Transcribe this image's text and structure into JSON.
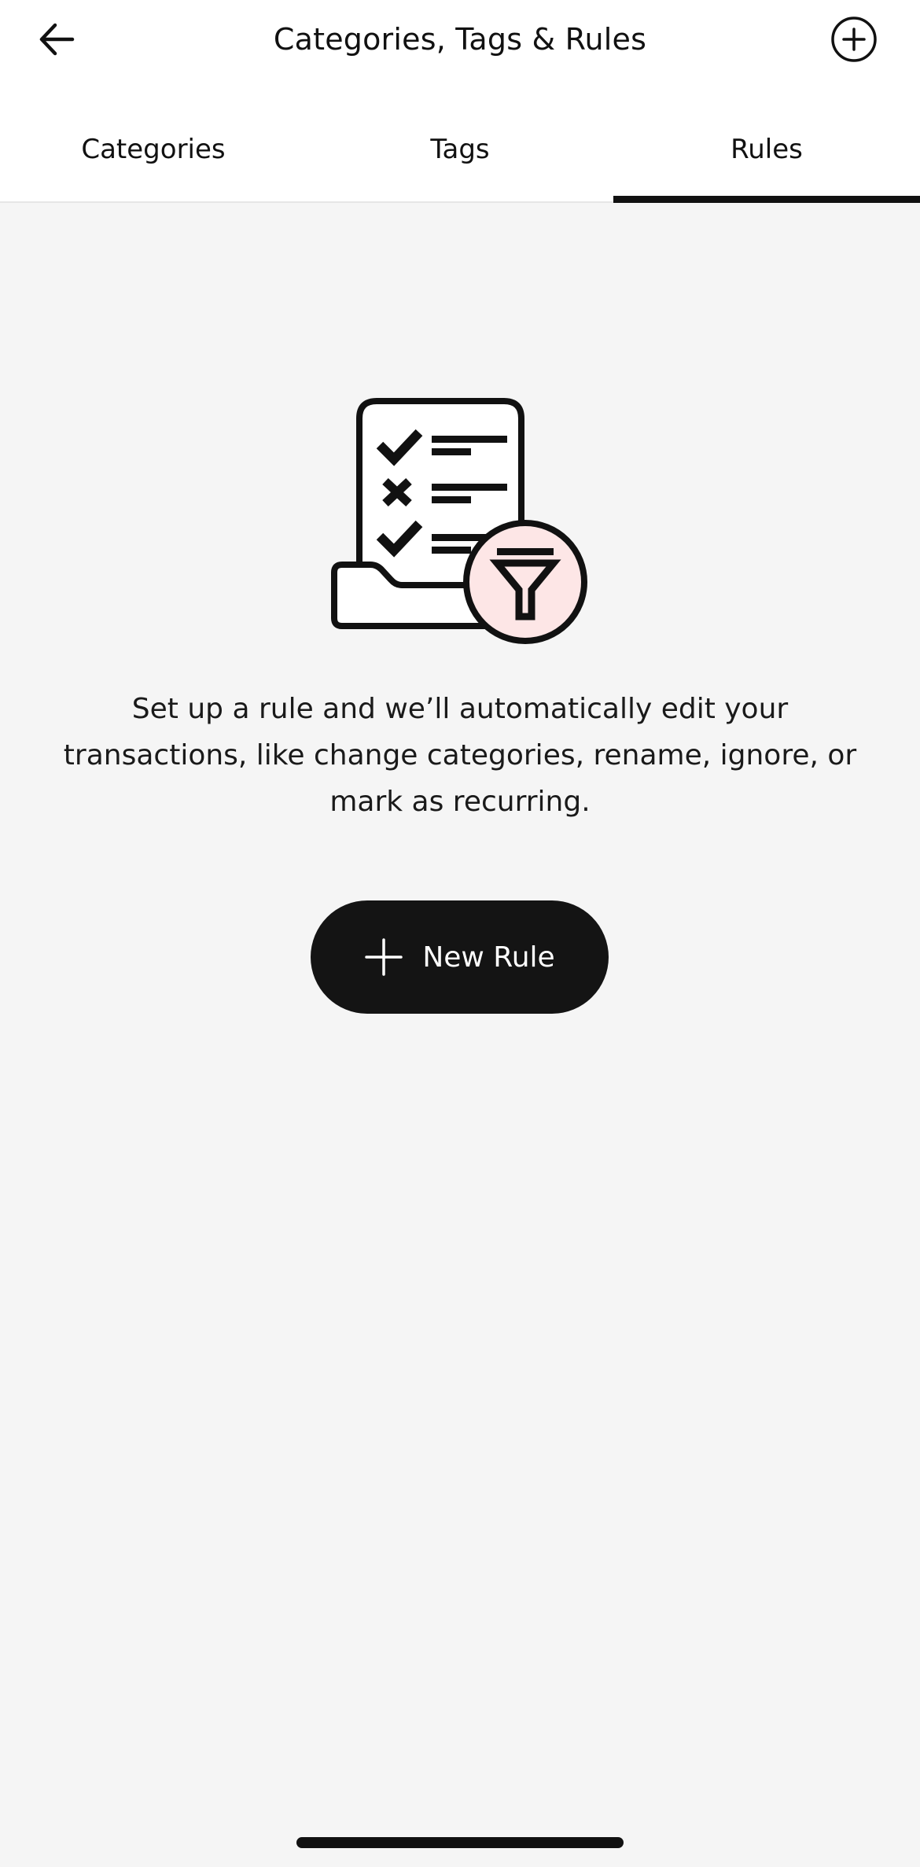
{
  "header": {
    "title": "Categories, Tags & Rules",
    "back_icon": "arrow-left-icon",
    "add_icon": "plus-circle-icon"
  },
  "tabs": [
    {
      "label": "Categories",
      "active": false
    },
    {
      "label": "Tags",
      "active": false
    },
    {
      "label": "Rules",
      "active": true
    }
  ],
  "empty_state": {
    "illustration_icon": "rules-checklist-filter-icon",
    "message": "Set up a rule and we’ll automatically edit your transactions, like change categories, rename, ignore, or mark as recurring.",
    "button_label": "New Rule",
    "button_icon": "plus-icon"
  },
  "colors": {
    "background": "#f5f5f5",
    "header": "#ffffff",
    "ink": "#111111",
    "filter_badge": "#fde6e6"
  }
}
